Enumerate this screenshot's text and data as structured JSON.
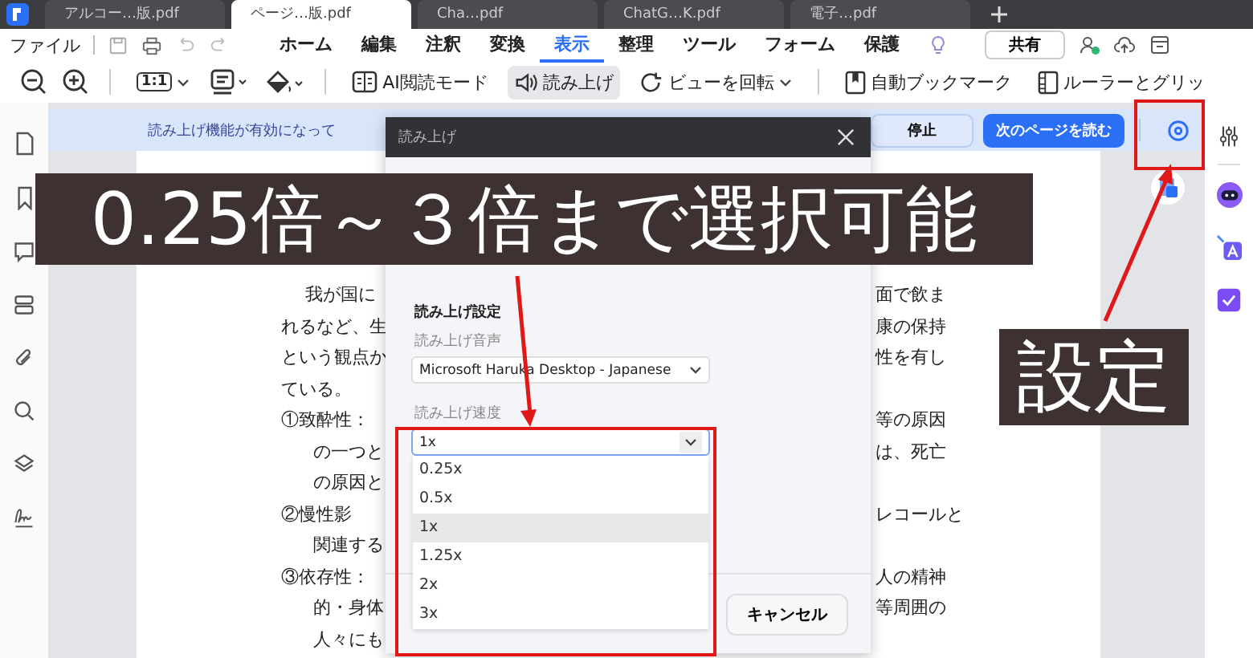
{
  "tabs": [
    {
      "label": "アルコー…版.pdf",
      "selected": false
    },
    {
      "label": "ページ…版.pdf",
      "selected": true
    },
    {
      "label": "Cha…pdf",
      "selected": false
    },
    {
      "label": "ChatG…K.pdf",
      "selected": false
    },
    {
      "label": "電子…pdf",
      "selected": false
    }
  ],
  "menu": {
    "file": "ファイル",
    "items": [
      {
        "label": "ホーム",
        "selected": false
      },
      {
        "label": "編集",
        "selected": false
      },
      {
        "label": "注釈",
        "selected": false
      },
      {
        "label": "変換",
        "selected": false
      },
      {
        "label": "表示",
        "selected": true
      },
      {
        "label": "整理",
        "selected": false
      },
      {
        "label": "ツール",
        "selected": false
      },
      {
        "label": "フォーム",
        "selected": false
      },
      {
        "label": "保護",
        "selected": false
      }
    ],
    "share": "共有"
  },
  "toolbar": {
    "actual_size": "1:1",
    "ai_mode": "AI閲読モード",
    "read_aloud": {
      "label": "読み上げ",
      "selected": true
    },
    "rotate": "ビューを回転",
    "bookmark": "自動ブックマーク",
    "ruler": "ルーラーとグリッ"
  },
  "read_bar": {
    "message": "読み上げ機能が有効になって",
    "stop": "停止",
    "next": "次のページを読む"
  },
  "document": {
    "lines": [
      {
        "kind": "para",
        "left": "我が国に",
        "right": "面で飲ま"
      },
      {
        "kind": "line",
        "left": "れるなど、生",
        "right": "康の保持"
      },
      {
        "kind": "line",
        "left": "という観点か",
        "right": "性を有し"
      },
      {
        "kind": "line",
        "left": "ている。"
      },
      {
        "kind": "item",
        "left": "①致酔性：",
        "right": "等の原因"
      },
      {
        "kind": "cont",
        "left": "の一つと",
        "right": "は、死亡"
      },
      {
        "kind": "cont",
        "left": "の原因と"
      },
      {
        "kind": "item",
        "left": "②慢性影",
        "right": "レコールと"
      },
      {
        "kind": "cont",
        "left": "関連する"
      },
      {
        "kind": "item",
        "left": "③依存性：",
        "right": "人の精神"
      },
      {
        "kind": "cont",
        "left": "的・身体",
        "right": "等周囲の"
      },
      {
        "kind": "cont",
        "left": "人々にも"
      }
    ]
  },
  "dialog": {
    "title": "読み上げ",
    "section": "読み上げ設定",
    "voice_label": "読み上げ音声",
    "voice": "Microsoft Haruka Desktop - Japanese",
    "speed_label": "読み上げ速度",
    "speed": "1x",
    "options": [
      {
        "label": "0.25x",
        "selected": false
      },
      {
        "label": "0.5x",
        "selected": false
      },
      {
        "label": "1x",
        "selected": true
      },
      {
        "label": "1.25x",
        "selected": false
      },
      {
        "label": "2x",
        "selected": false
      },
      {
        "label": "3x",
        "selected": false
      }
    ],
    "cancel": "キャンセル"
  },
  "annotations": {
    "caption": "0.25倍～３倍まで選択可能",
    "settings_caption": "設定"
  }
}
